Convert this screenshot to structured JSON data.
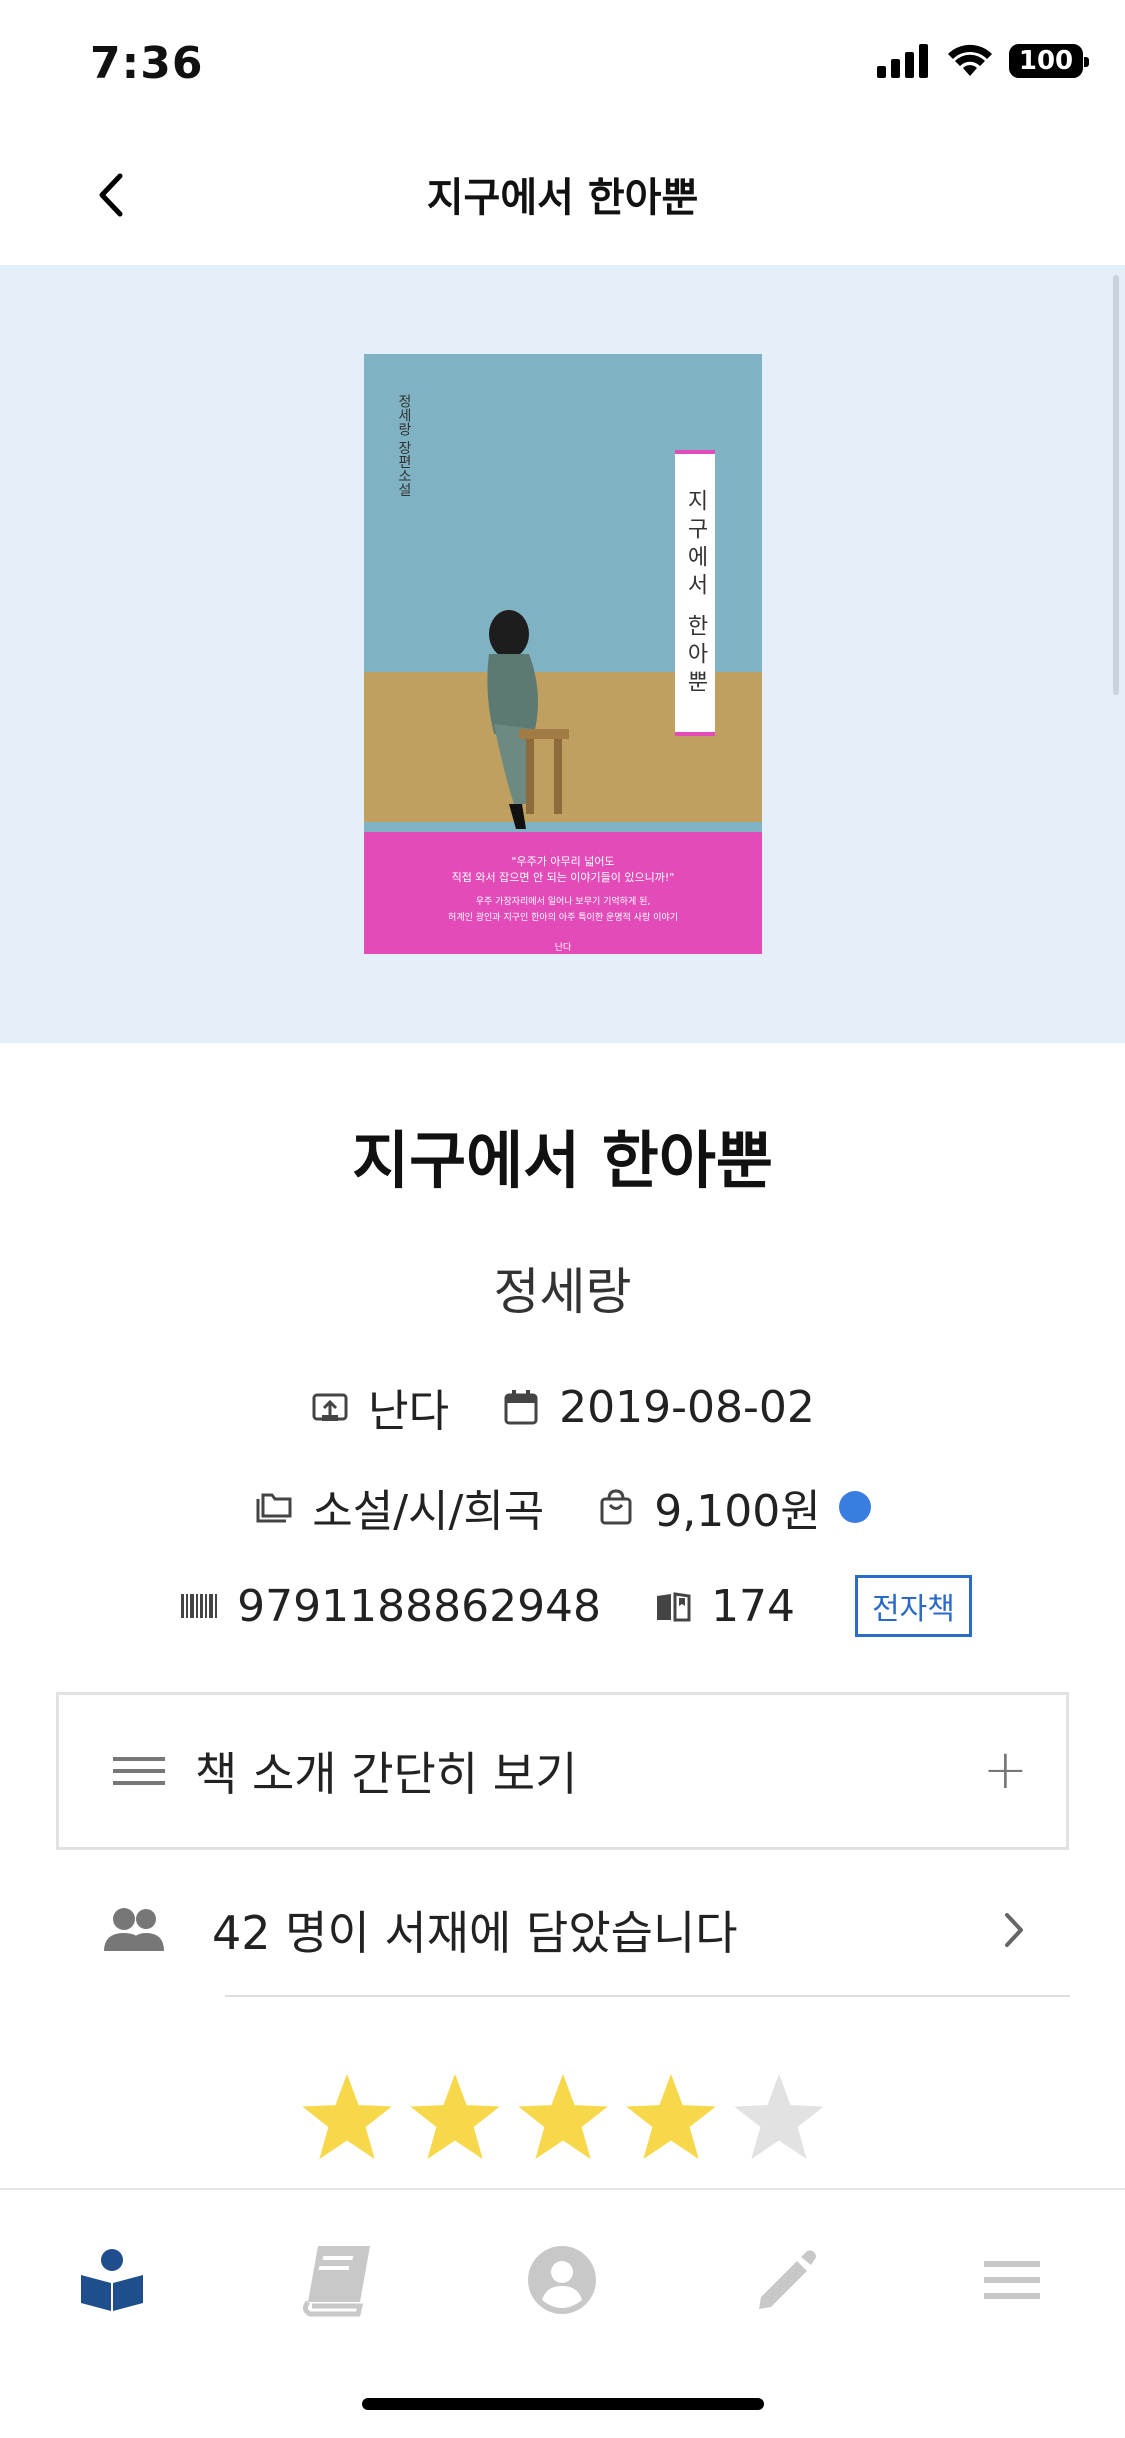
{
  "status_bar": {
    "time": "7:36",
    "battery": "100"
  },
  "nav": {
    "title": "지구에서 한아뿐"
  },
  "cover": {
    "band_text": "지구에서 한아뿐",
    "author_text": "정세랑 장편소설",
    "tagline_line1": "\"우주가 아무리 넓어도",
    "tagline_line2": "직접 와서 잡으면 안 되는 이야기들이 있으니까!\"",
    "blurb_line1": "우주 가장자리에서 일어나 보무기 기억하게 된,",
    "blurb_line2": "허계인 광인과 지구인 한아의 아주 특이한 운명적 사랑 이야기",
    "publisher_mark": "난다"
  },
  "book": {
    "title": "지구에서 한아뿐",
    "author": "정세랑",
    "publisher": "난다",
    "date": "2019-08-02",
    "category": "소설/시/희곡",
    "price": "9,100원",
    "isbn": "9791188862948",
    "pages": "174",
    "ebook_badge": "전자책"
  },
  "intro": {
    "label": "책 소개 간단히 보기",
    "plus": "+"
  },
  "readers": {
    "text": "42 명이 서재에 담았습니다"
  },
  "rating": {
    "filled": 4,
    "total": 5
  },
  "colors": {
    "star_on": "#f6d84a",
    "star_off": "#e2e2e2",
    "accent": "#2a6ac9",
    "hero_bg": "#e4effa",
    "tab_active": "#1f4e8c",
    "tab_inactive": "#c8c8c8"
  },
  "tabs": [
    {
      "icon": "book-reader-icon",
      "active": true
    },
    {
      "icon": "book-icon",
      "active": false
    },
    {
      "icon": "account-icon",
      "active": false
    },
    {
      "icon": "pencil-icon",
      "active": false
    },
    {
      "icon": "menu-icon",
      "active": false
    }
  ]
}
